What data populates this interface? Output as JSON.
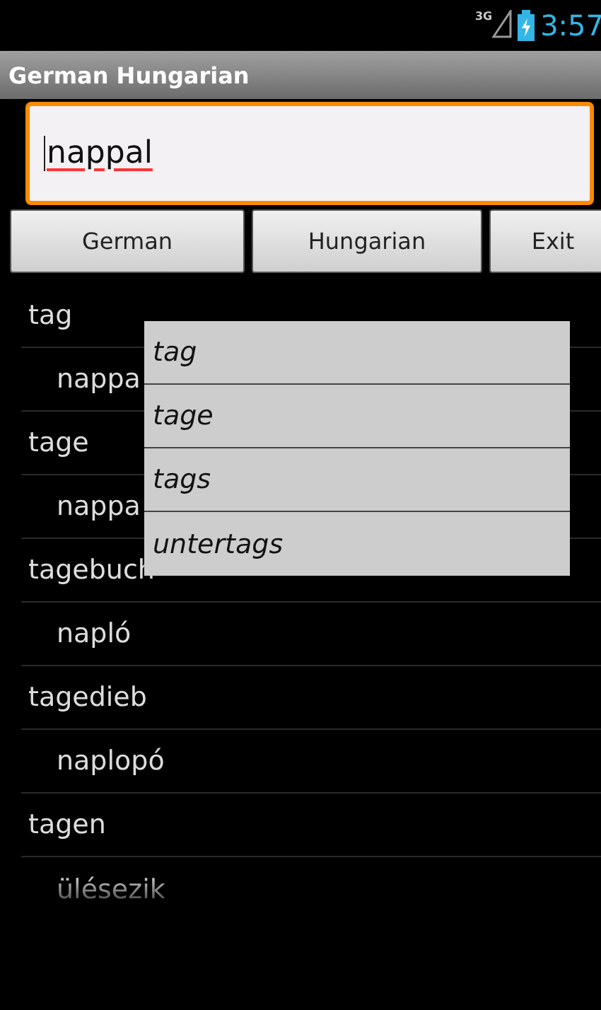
{
  "status_bar": {
    "network": "3G",
    "time": "3:57"
  },
  "title_bar": {
    "title": "German Hungarian"
  },
  "search": {
    "value": "nappal"
  },
  "buttons": [
    {
      "label": "German"
    },
    {
      "label": "Hungarian"
    },
    {
      "label": "Exit"
    }
  ],
  "entries": [
    {
      "headword": "tag",
      "translation": "nappa"
    },
    {
      "headword": "tage",
      "translation": "nappa"
    },
    {
      "headword": "tagebuch",
      "translation": "napló"
    },
    {
      "headword": "tagedieb",
      "translation": "naplopó"
    },
    {
      "headword": "tagen",
      "translation": "ülésezik"
    }
  ],
  "suggestions": [
    "tag",
    "tage",
    "tags",
    "untertags"
  ]
}
